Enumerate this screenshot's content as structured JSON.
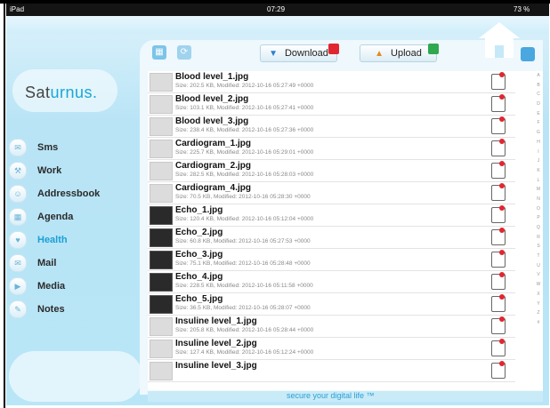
{
  "status": {
    "carrier": "iPad",
    "time": "07:29",
    "battery": "73 %"
  },
  "logo": {
    "text_left": "Sat",
    "text_right": "urnus."
  },
  "toolbar": {
    "download_label": "Download",
    "upload_label": "Upload",
    "colors": {
      "download_flag": "#e0262f",
      "upload_flag": "#2fa84f",
      "accent": "#1a9fd6"
    }
  },
  "sidebar": {
    "items": [
      {
        "label": "Sms"
      },
      {
        "label": "Work"
      },
      {
        "label": "Addressbook"
      },
      {
        "label": "Agenda"
      },
      {
        "label": "Health"
      },
      {
        "label": "Mail"
      },
      {
        "label": "Media"
      },
      {
        "label": "Notes"
      }
    ]
  },
  "files": [
    {
      "name": "Blood level_1.jpg",
      "meta": "Size: 202.5 KB, Modified: 2012-10-16 05:27:49 +0000"
    },
    {
      "name": "Blood level_2.jpg",
      "meta": "Size: 103.1 KB, Modified: 2012-10-16 05:27:41 +0000"
    },
    {
      "name": "Blood level_3.jpg",
      "meta": "Size: 238.4 KB, Modified: 2012-10-16 05:27:36 +0000"
    },
    {
      "name": "Cardiogram_1.jpg",
      "meta": "Size: 225.7 KB, Modified: 2012-10-16 05:29:01 +0000"
    },
    {
      "name": "Cardiogram_2.jpg",
      "meta": "Size: 282.5 KB, Modified: 2012-10-16 05:28:03 +0000"
    },
    {
      "name": "Cardiogram_4.jpg",
      "meta": "Size: 70.5 KB, Modified: 2012-10-16 05:28:30 +0000"
    },
    {
      "name": "Echo_1.jpg",
      "meta": "Size: 120.4 KB, Modified: 2012-10-16 05:12:04 +0000"
    },
    {
      "name": "Echo_2.jpg",
      "meta": "Size: 60.8 KB, Modified: 2012-10-16 05:27:53 +0000"
    },
    {
      "name": "Echo_3.jpg",
      "meta": "Size: 75.1 KB, Modified: 2012-10-16 05:28:48 +0000"
    },
    {
      "name": "Echo_4.jpg",
      "meta": "Size: 228.5 KB, Modified: 2012-10-16 05:11:58 +0000"
    },
    {
      "name": "Echo_5.jpg",
      "meta": "Size: 36.5 KB, Modified: 2012-10-16 05:28:07 +0000"
    },
    {
      "name": "Insuline level_1.jpg",
      "meta": "Size: 205.8 KB, Modified: 2012-10-16 05:28:44 +0000"
    },
    {
      "name": "Insuline level_2.jpg",
      "meta": "Size: 127.4 KB, Modified: 2012-10-16 05:12:24 +0000"
    },
    {
      "name": "Insuline level_3.jpg",
      "meta": ""
    }
  ],
  "index_letters": [
    "A",
    "B",
    "C",
    "D",
    "E",
    "F",
    "G",
    "H",
    "I",
    "J",
    "K",
    "L",
    "M",
    "N",
    "O",
    "P",
    "Q",
    "R",
    "S",
    "T",
    "U",
    "V",
    "W",
    "X",
    "Y",
    "Z",
    "#"
  ],
  "footer": {
    "tagline": "secure your digital life ™"
  }
}
